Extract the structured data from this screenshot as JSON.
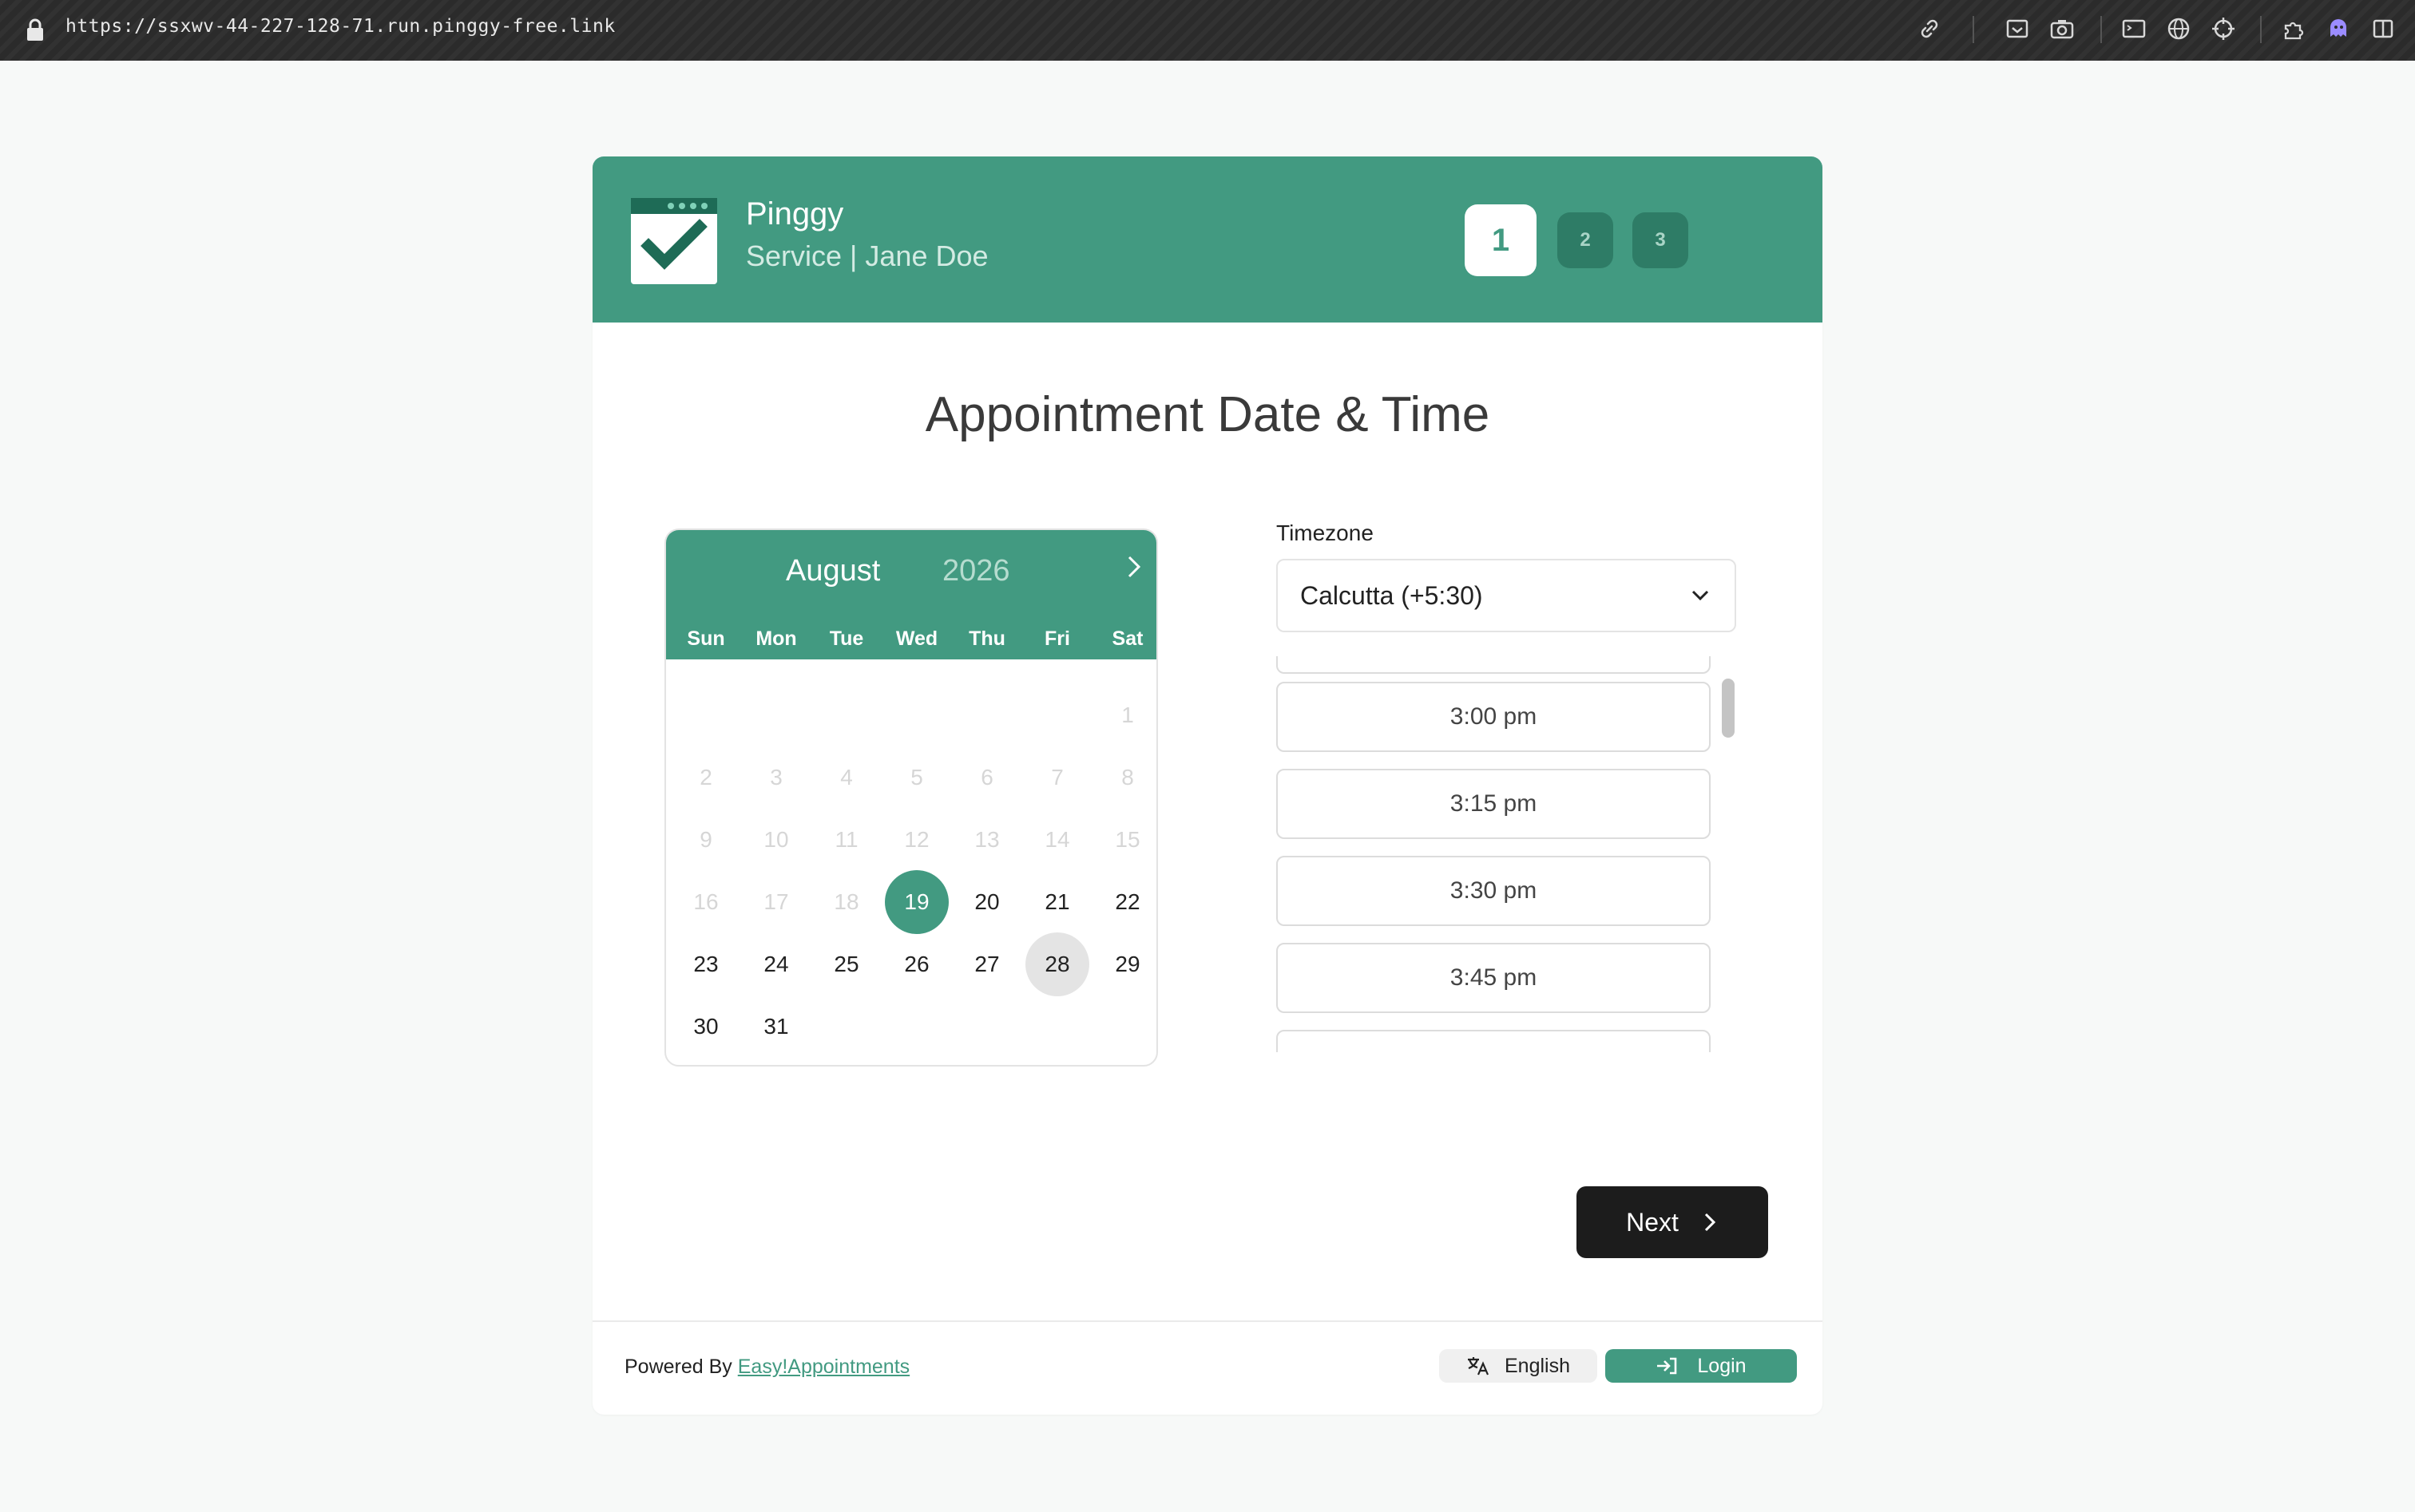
{
  "browser": {
    "url": "https://ssxwv-44-227-128-71.run.pinggy-free.link"
  },
  "header": {
    "company": "Pinggy",
    "subtitle": "Service | Jane Doe",
    "steps": [
      "1",
      "2",
      "3"
    ],
    "active_step": "1"
  },
  "main": {
    "title": "Appointment Date & Time"
  },
  "calendar": {
    "month": "August",
    "year": "2026",
    "weekdays": [
      "Sun",
      "Mon",
      "Tue",
      "Wed",
      "Thu",
      "Fri",
      "Sat"
    ],
    "weeks": [
      [
        "",
        "",
        "",
        "",
        "",
        "",
        "1"
      ],
      [
        "2",
        "3",
        "4",
        "5",
        "6",
        "7",
        "8"
      ],
      [
        "9",
        "10",
        "11",
        "12",
        "13",
        "14",
        "15"
      ],
      [
        "16",
        "17",
        "18",
        "19",
        "20",
        "21",
        "22"
      ],
      [
        "23",
        "24",
        "25",
        "26",
        "27",
        "28",
        "29"
      ],
      [
        "30",
        "31",
        "",
        "",
        "",
        "",
        ""
      ]
    ],
    "first_available_day": 19,
    "selected_day": 19,
    "hovered_day": 28
  },
  "timezone": {
    "label": "Timezone",
    "value": "Calcutta (+5:30)"
  },
  "slots": [
    "3:00 pm",
    "3:15 pm",
    "3:30 pm",
    "3:45 pm"
  ],
  "actions": {
    "next_label": "Next"
  },
  "footer": {
    "powered_by": "Powered By",
    "powered_link": "Easy!Appointments",
    "language": "English",
    "login": "Login"
  },
  "colors": {
    "primary": "#429a81",
    "dark": "#1c1c1c"
  }
}
